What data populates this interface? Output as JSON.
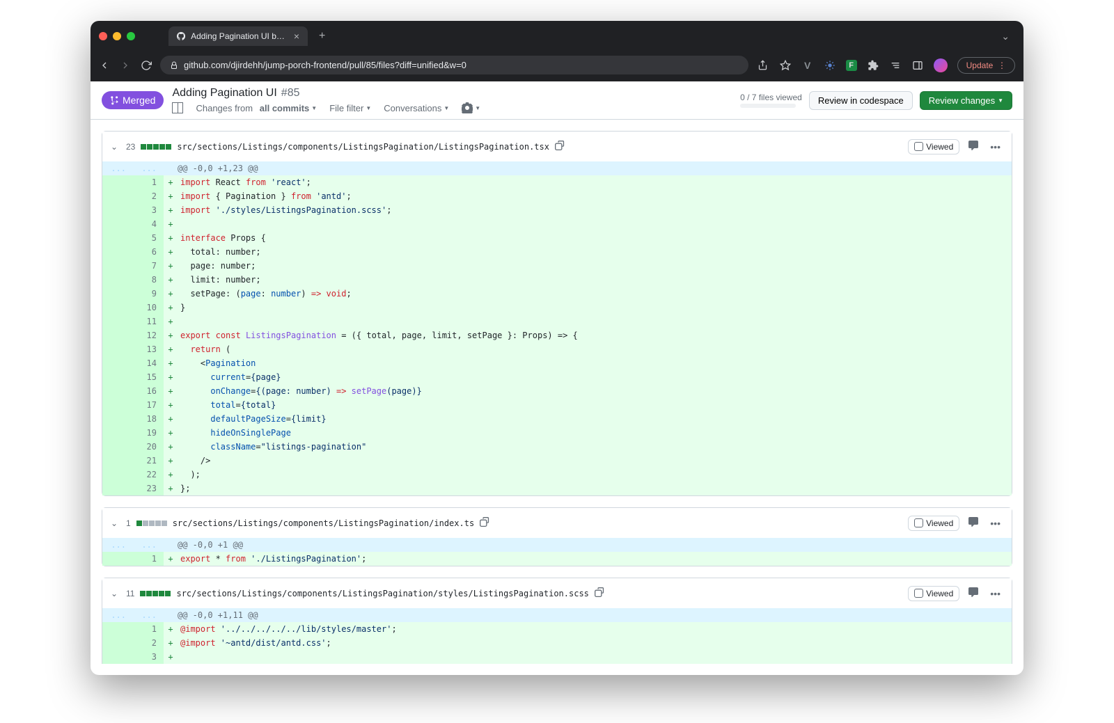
{
  "browser": {
    "tab_title": "Adding Pagination UI by djirde",
    "url": "github.com/djirdehh/jump-porch-frontend/pull/85/files?diff=unified&w=0",
    "update_label": "Update"
  },
  "pr": {
    "merged_label": "Merged",
    "title": "Adding Pagination UI",
    "number": "#85",
    "filters": {
      "changes_from_label": "Changes from",
      "changes_from_value": "all commits",
      "file_filter": "File filter",
      "conversations": "Conversations"
    },
    "files_viewed": "0 / 7 files viewed",
    "review_codespace": "Review in codespace",
    "review_changes": "Review changes"
  },
  "file1": {
    "count": "23",
    "path": "src/sections/Listings/components/ListingsPagination/ListingsPagination.tsx",
    "hunk": "@@ -0,0 +1,23 @@",
    "viewed": "Viewed"
  },
  "file2": {
    "count": "1",
    "path": "src/sections/Listings/components/ListingsPagination/index.ts",
    "hunk": "@@ -0,0 +1 @@",
    "viewed": "Viewed"
  },
  "file3": {
    "count": "11",
    "path": "src/sections/Listings/components/ListingsPagination/styles/ListingsPagination.scss",
    "hunk": "@@ -0,0 +1,11 @@",
    "viewed": "Viewed"
  },
  "code1": {
    "l1_import": "import",
    "l1_from": "from",
    "l1_react": " React ",
    "l1_str": "'react'",
    "l2_import": "import",
    "l2_from": "from",
    "l2_pag": " { Pagination } ",
    "l2_str": "'antd'",
    "l3_import": "import",
    "l3_str": "'./styles/ListingsPagination.scss'",
    "l5_interface": "interface",
    "l5_props": " Props {",
    "l6": "  total: number;",
    "l7": "  page: number;",
    "l8": "  limit: number;",
    "l9a": "  setPage: (",
    "l9b": "page",
    "l9c": ": ",
    "l9d": "number",
    "l9e": ") ",
    "l9f": "=>",
    "l9g": " void",
    "l9h": ";",
    "l10": "}",
    "l12_export": "export",
    "l12_const": "const",
    "l12_name": " ListingsPagination ",
    "l12_eq": "= ({ total, page, limit, setPage }: Props) => {",
    "l13_return": "return",
    "l13_paren": " (",
    "l14a": "    <",
    "l14b": "Pagination",
    "l15a": "      ",
    "l15b": "current",
    "l15c": "=",
    "l15d": "{page}",
    "l16a": "      ",
    "l16b": "onChange",
    "l16c": "=",
    "l16d": "{(page: number) ",
    "l16e": "=>",
    "l16f": " setPage",
    "l16g": "(page)}",
    "l17a": "      ",
    "l17b": "total",
    "l17c": "=",
    "l17d": "{total}",
    "l18a": "      ",
    "l18b": "defaultPageSize",
    "l18c": "=",
    "l18d": "{limit}",
    "l19a": "      ",
    "l19b": "hideOnSinglePage",
    "l20a": "      ",
    "l20b": "className",
    "l20c": "=",
    "l20d": "\"listings-pagination\"",
    "l21": "    />",
    "l22": "  );",
    "l23": "};"
  },
  "code2": {
    "l1_export": "export",
    "l1_star": " * ",
    "l1_from": "from",
    "l1_str": " './ListingsPagination'",
    "l1_semi": ";"
  },
  "code3": {
    "l1_import": "@import",
    "l1_str": " '../../../../../lib/styles/master'",
    "l1_semi": ";",
    "l2_import": "@import",
    "l2_str": " '~antd/dist/antd.css'",
    "l2_semi": ";"
  }
}
